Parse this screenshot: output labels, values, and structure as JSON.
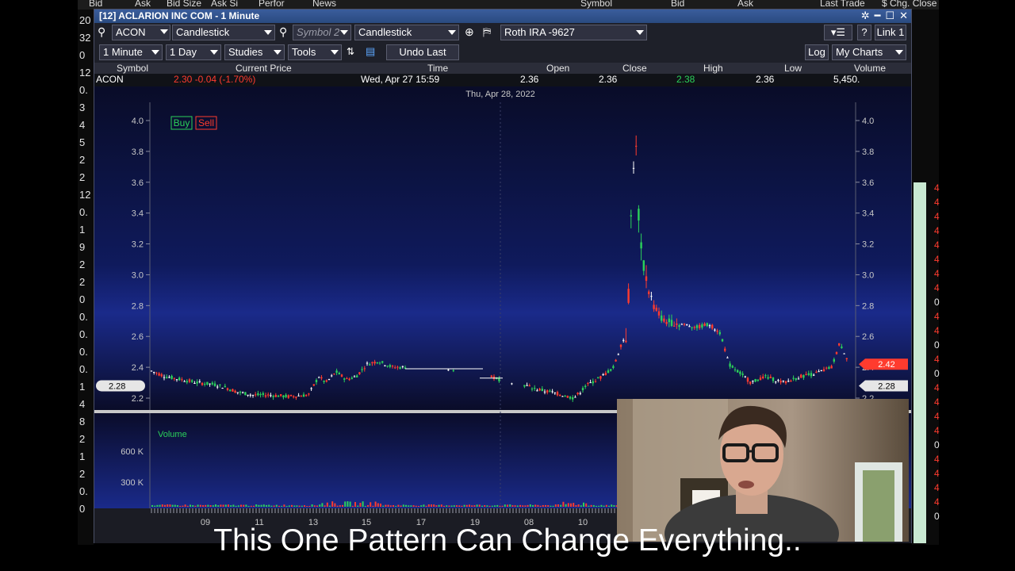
{
  "window": {
    "title": "[12] ACLARION INC COM - 1 Minute",
    "link_label": "Link 1",
    "help_label": "?"
  },
  "background_headers": [
    "Bid",
    "Ask",
    "Bid Size",
    "Ask Si",
    "Perfor",
    "News",
    "Symbol",
    "Bid",
    "Ask",
    "Last Trade",
    "$ Chg. Close"
  ],
  "background_left_values": [
    "20",
    "32",
    "0",
    "12",
    "0.",
    "3",
    "4",
    "5",
    "2",
    "2",
    "12",
    "0.",
    "1",
    "9",
    "2",
    "2",
    "0",
    "0.",
    "0.",
    "0.",
    "0.",
    "1",
    "4",
    "8",
    "2",
    "1",
    "2",
    "0.",
    "0"
  ],
  "background_right_values": [
    "4",
    "4",
    "4",
    "4",
    "4",
    "4",
    "4",
    "4",
    "0",
    "4",
    "4",
    "0",
    "4",
    "0",
    "4",
    "4",
    "4",
    "4",
    "0",
    "4",
    "4",
    "4",
    "4",
    "0"
  ],
  "toolbar1": {
    "symbol1": "ACON",
    "chart_type1": "Candlestick",
    "symbol2_placeholder": "Symbol 2",
    "chart_type2": "Candlestick",
    "account": "Roth IRA -9627"
  },
  "toolbar2": {
    "interval": "1 Minute",
    "range": "1 Day",
    "studies": "Studies",
    "tools": "Tools",
    "undo": "Undo Last",
    "log": "Log",
    "my_charts": "My Charts"
  },
  "quote": {
    "headers": [
      "Symbol",
      "Current Price",
      "Time",
      "Open",
      "Close",
      "High",
      "Low",
      "Volume"
    ],
    "symbol": "ACON",
    "current_price": "2.30  -0.04  (-1.70%)",
    "time": "Wed, Apr 27  15:59",
    "open": "2.36",
    "close": "2.36",
    "high": "2.38",
    "low": "2.36",
    "volume": "5,450."
  },
  "chart_data": {
    "type": "candlestick",
    "date_label": "Thu, Apr 28, 2022",
    "y_ticks": [
      "4.0",
      "3.8",
      "3.6",
      "3.4",
      "3.2",
      "3.0",
      "2.8",
      "2.6",
      "2.4",
      "2.2"
    ],
    "ylim": [
      2.2,
      4.0
    ],
    "last_price_tag": "2.42",
    "left_price_tag": "2.28",
    "right_price_tag": "2.28",
    "volume_label": "Volume",
    "volume_ticks": [
      "600 K",
      "300 K"
    ],
    "x_ticks": [
      "09",
      "11",
      "13",
      "15",
      "17",
      "19",
      "08",
      "10"
    ],
    "buy_label": "Buy",
    "sell_label": "Sell",
    "colors": {
      "up": "#2bd15a",
      "down": "#ff3b2e",
      "neutral": "#ffffff",
      "tag": "#ff3b2e"
    }
  },
  "caption": "This One Pattern Can Change Everything.."
}
